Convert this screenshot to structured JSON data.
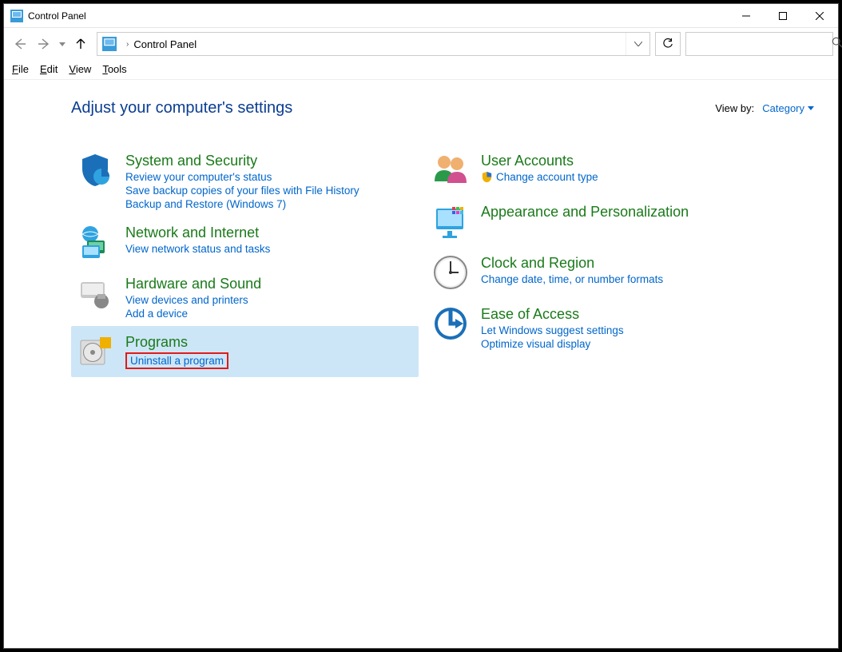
{
  "window": {
    "title": "Control Panel"
  },
  "address": {
    "location": "Control Panel"
  },
  "search": {
    "placeholder": ""
  },
  "menu": {
    "file": "File",
    "edit": "Edit",
    "view": "View",
    "tools": "Tools"
  },
  "header": {
    "title": "Adjust your computer's settings",
    "viewby_label": "View by:",
    "viewby_value": "Category"
  },
  "left": [
    {
      "title": "System and Security",
      "links": [
        "Review your computer's status",
        "Save backup copies of your files with File History",
        "Backup and Restore (Windows 7)"
      ],
      "highlight_index": -1
    },
    {
      "title": "Network and Internet",
      "links": [
        "View network status and tasks"
      ],
      "highlight_index": -1
    },
    {
      "title": "Hardware and Sound",
      "links": [
        "View devices and printers",
        "Add a device"
      ],
      "highlight_index": -1
    },
    {
      "title": "Programs",
      "links": [
        "Uninstall a program"
      ],
      "highlight_index": 0,
      "selected": true
    }
  ],
  "right": [
    {
      "title": "User Accounts",
      "links": [
        "Change account type"
      ],
      "shield": true
    },
    {
      "title": "Appearance and Personalization",
      "links": []
    },
    {
      "title": "Clock and Region",
      "links": [
        "Change date, time, or number formats"
      ]
    },
    {
      "title": "Ease of Access",
      "links": [
        "Let Windows suggest settings",
        "Optimize visual display"
      ]
    }
  ]
}
